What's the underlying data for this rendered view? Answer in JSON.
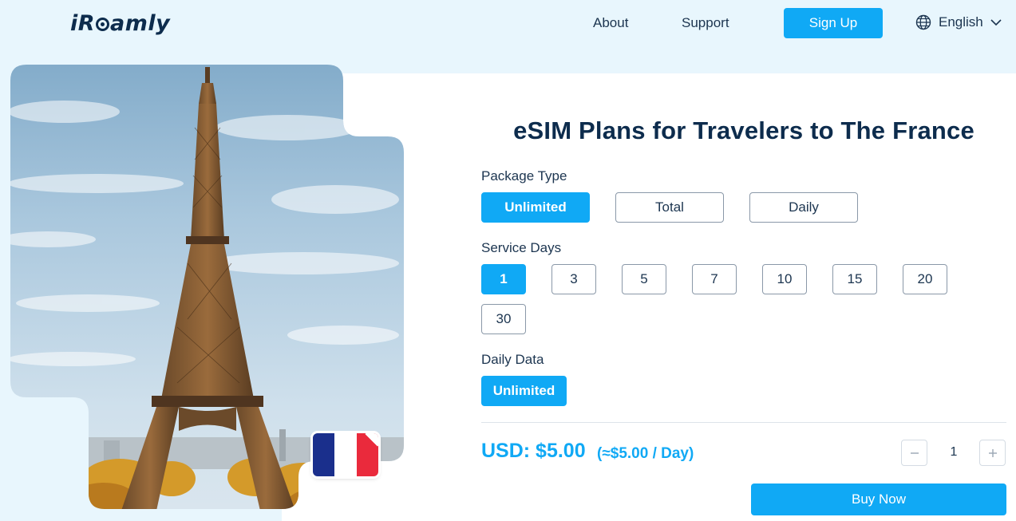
{
  "brand": {
    "logo_text_1": "iR",
    "logo_text_2": "amly"
  },
  "nav": {
    "about": "About",
    "support": "Support",
    "signup": "Sign Up",
    "language": "English"
  },
  "icons": {
    "globe": "globe-icon",
    "chevron": "chevron-down-icon",
    "minus": "minus-icon",
    "plus": "plus-icon"
  },
  "colors": {
    "accent": "#10a9f5",
    "navy": "#0d2c4d",
    "band": "#e8f6fd"
  },
  "hero": {
    "alt": "eiffel-tower-photo",
    "flag": "france-flag"
  },
  "plan": {
    "title": "eSIM Plans for Travelers to The France",
    "package_type_label": "Package Type",
    "package_types": [
      "Unlimited",
      "Total",
      "Daily"
    ],
    "package_selected": "Unlimited",
    "service_days_label": "Service Days",
    "service_days": [
      "1",
      "3",
      "5",
      "7",
      "10",
      "15",
      "20",
      "30"
    ],
    "service_days_selected": "1",
    "daily_data_label": "Daily Data",
    "daily_data_options": [
      "Unlimited"
    ],
    "daily_data_selected": "Unlimited",
    "price": "USD: $5.00",
    "per_day": "(≈$5.00 / Day)",
    "quantity": "1",
    "buy_label": "Buy Now"
  }
}
